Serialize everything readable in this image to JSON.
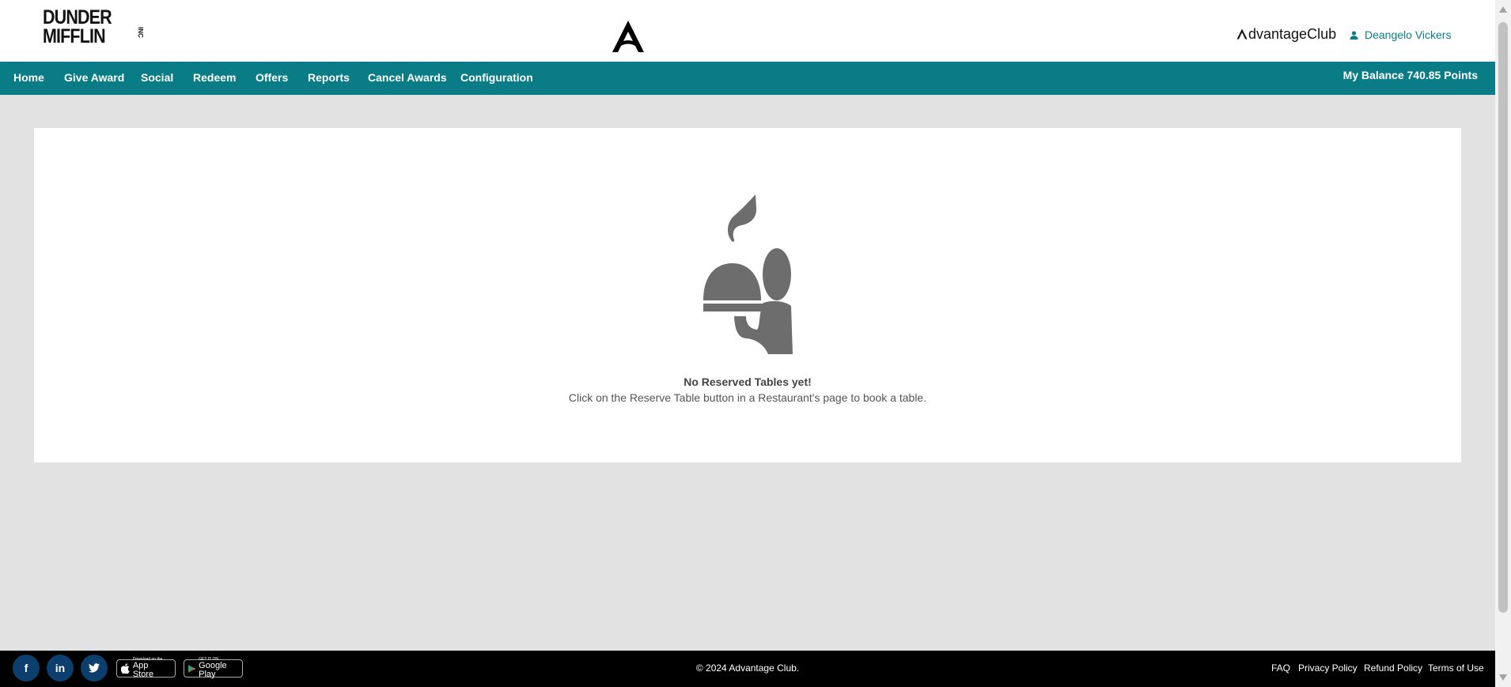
{
  "header": {
    "company_logo_line1": "DUNDER",
    "company_logo_line2": "MIFFLIN",
    "company_logo_inc": "INC",
    "brand_name": "dvantageClub",
    "user_name": "Deangelo Vickers"
  },
  "nav": {
    "items": [
      {
        "label": "Home"
      },
      {
        "label": "Give Award"
      },
      {
        "label": "Social"
      },
      {
        "label": "Redeem"
      },
      {
        "label": "Offers"
      },
      {
        "label": "Reports"
      },
      {
        "label": "Cancel Awards"
      },
      {
        "label": "Configuration"
      }
    ],
    "balance": "My Balance 740.85 Points"
  },
  "main": {
    "illustration_icon": "waiter-serving-tray-icon",
    "empty_title": "No Reserved Tables yet!",
    "empty_subtitle": "Click on the Reserve Table button in a Restaurant's page to book a table."
  },
  "footer": {
    "social": [
      {
        "icon": "facebook-icon",
        "glyph": "f"
      },
      {
        "icon": "linkedin-icon",
        "glyph": "in"
      }
    ],
    "app_store_small": "Download on the",
    "app_store_big": "App Store",
    "google_play_small": "GET IT ON",
    "google_play_big": "Google Play",
    "copyright": "© 2024 Advantage Club.",
    "links": [
      {
        "label": "FAQ"
      },
      {
        "label": "Privacy Policy"
      },
      {
        "label": "Refund Policy"
      },
      {
        "label": "Terms of Use"
      }
    ]
  },
  "colors": {
    "accent": "#0a7c85",
    "page_background": "#e2e2e2",
    "footer_background": "#000000",
    "illustration": "#6d6d6d"
  }
}
